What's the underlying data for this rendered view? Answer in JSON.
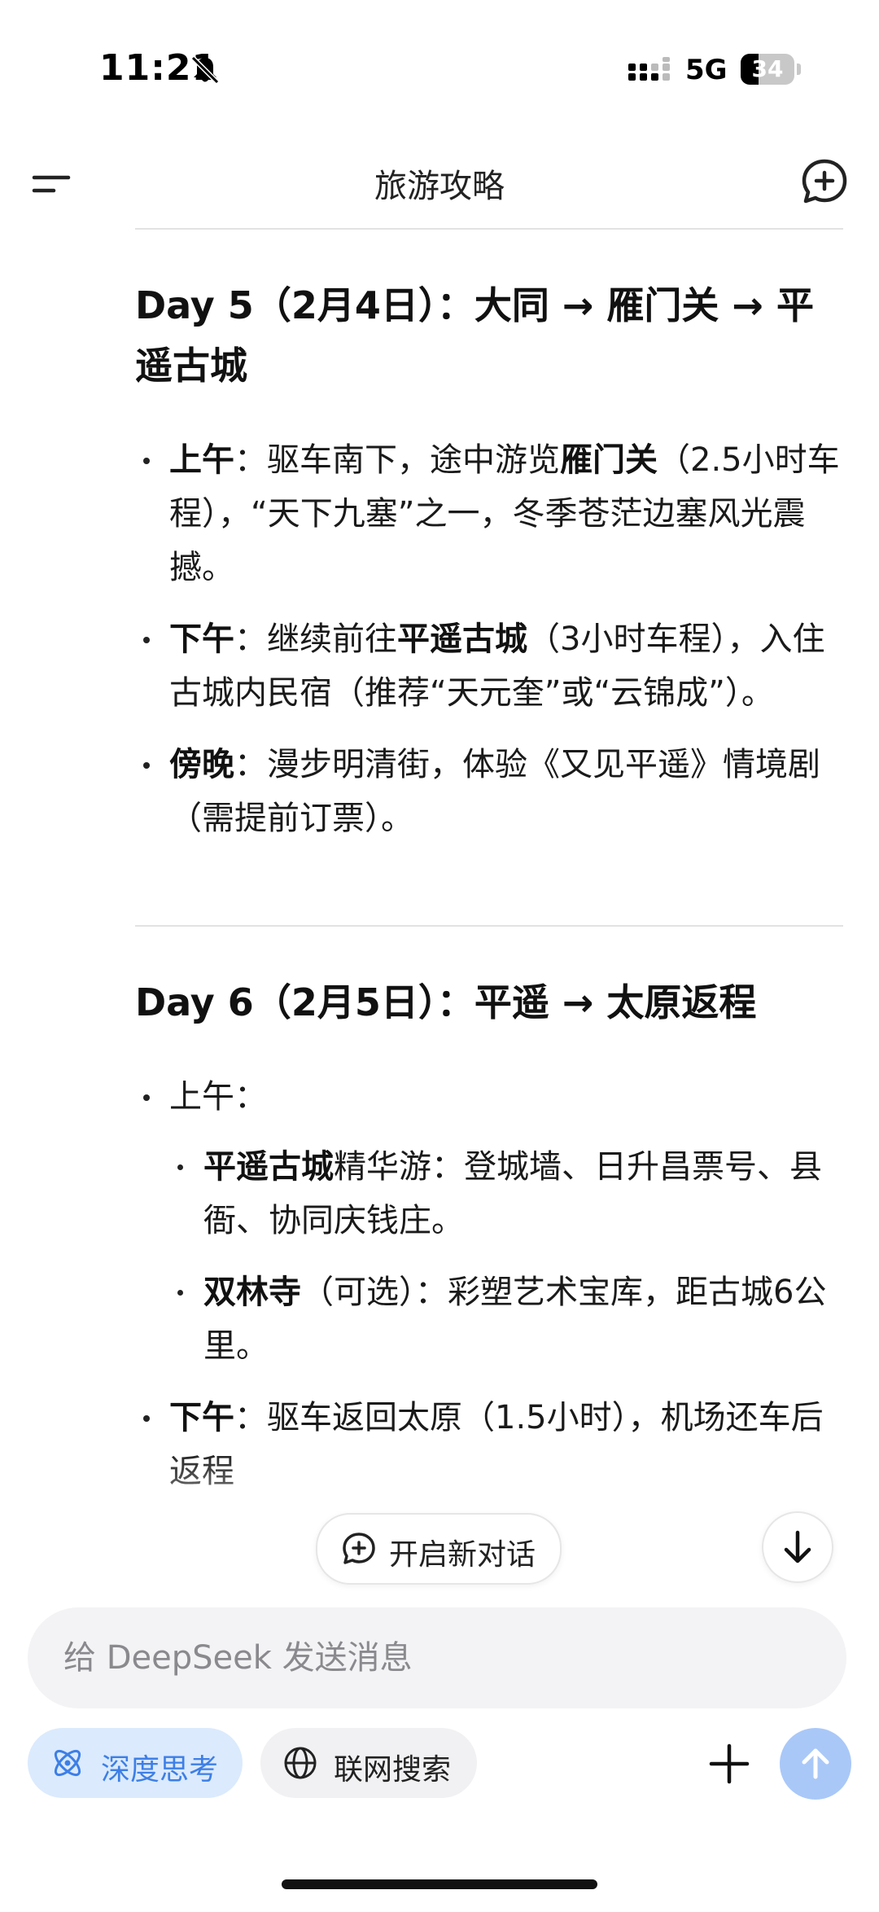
{
  "status_bar": {
    "time": "11:21",
    "network": "5G",
    "battery": "34",
    "battery_level": 0.34
  },
  "header": {
    "title": "旅游攻略"
  },
  "sections": [
    {
      "title": "Day 5（2月4日）：大同 → 雁门关 → 平遥古城",
      "items": [
        {
          "label": "上午",
          "sep": "：",
          "before": "驱车南下，途中游览",
          "bold": "雁门关",
          "after": "（2.5小时车程），“天下九塞”之一，冬季苍茫边塞风光震撼。"
        },
        {
          "label": "下午",
          "sep": "：",
          "before": "继续前往",
          "bold": "平遥古城",
          "after": "（3小时车程），入住古城内民宿（推荐“天元奎”或“云锦成”）。"
        },
        {
          "label": "傍晚",
          "sep": "：",
          "before": "漫步明清街，体验《又见平遥》情境剧（需提前订票）。",
          "bold": "",
          "after": ""
        }
      ]
    },
    {
      "title": "Day 6（2月5日）：平遥 → 太原返程",
      "morning_label": "上午",
      "morning_sep": "：",
      "sub_items": [
        {
          "bold": "平遥古城",
          "text": "精华游：登城墙、日升昌票号、县衙、协同庆钱庄。"
        },
        {
          "bold": "双林寺",
          "text": "（可选）：彩塑艺术宝库，距古城6公里。"
        }
      ],
      "afternoon": {
        "label": "下午",
        "sep": "：",
        "text": "驱车返回太原（1.5小时），机场还车后返程"
      }
    }
  ],
  "floating": {
    "new_chat_label": "开启新对话"
  },
  "composer": {
    "placeholder": "给 DeepSeek 发送消息",
    "deep_think_label": "深度思考",
    "web_search_label": "联网搜索"
  },
  "colors": {
    "accent": "#3d7fe6",
    "deep_think_bg": "#dbeafd",
    "send_button": "#a9c8f8",
    "input_bg": "#f3f3f5"
  },
  "icons": {
    "menu": "menu-icon",
    "new_chat": "new-chat-icon",
    "bell_muted": "bell-slash-icon",
    "signal": "signal-icon",
    "deep_think": "atom-icon",
    "web_search": "globe-icon",
    "attach": "plus-icon",
    "send": "arrow-up-icon",
    "scroll_down": "arrow-down-icon"
  }
}
